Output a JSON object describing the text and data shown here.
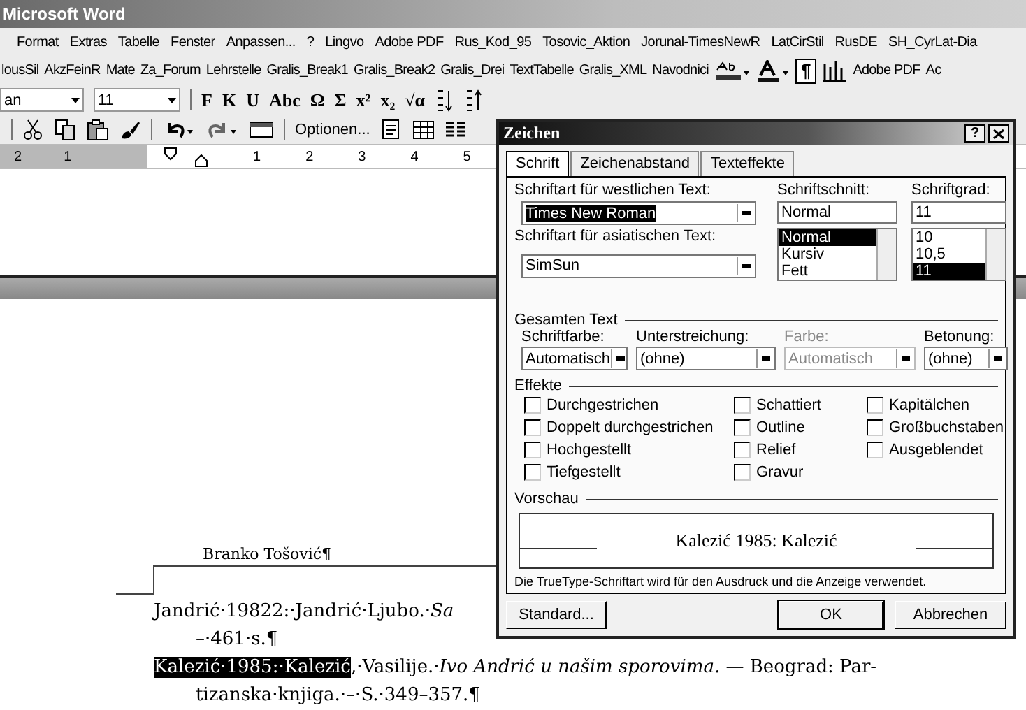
{
  "title_bar": {
    "title": "Microsoft Word"
  },
  "menu_bar": [
    "Format",
    "Extras",
    "Tabelle",
    "Fenster",
    "Anpassen...",
    "?",
    "Lingvo",
    "Adobe PDF",
    "Rus_Kod_95",
    "Tosovic_Aktion",
    "Jorunal-TimesNewR",
    "LatCirStil",
    "RusDE",
    "SH_CyrLat-Dia"
  ],
  "custom_toolbar": {
    "macros": [
      "lousSil",
      "AkzFeinR",
      "Mate",
      "Za_Forum",
      "Lehrstelle",
      "Gralis_Break1",
      "Gralis_Break2",
      "Gralis_Drei",
      "TextTabelle",
      "Gralis_XML",
      "Navodnici"
    ],
    "pilcrow": {
      "label": "¶",
      "on": true
    },
    "pdf": "Adobe PDF",
    "tail": "Ac"
  },
  "formatting_toolbar": {
    "font": "an",
    "size": "11",
    "buttons": [
      "F",
      "K",
      "U",
      "Abc",
      "Ω",
      "Σ",
      "x²",
      "x₂",
      "√α"
    ]
  },
  "standard_toolbar": {
    "options": "Optionen..."
  },
  "ruler": {
    "marks": [
      "2",
      "1",
      "1",
      "2",
      "3",
      "4",
      "5"
    ]
  },
  "document": {
    "header": "Branko Tošović¶",
    "lines": [
      {
        "kind": "first",
        "text": "Jandrić·19822:·Jandrić·Ljubo.·*Sa*"
      },
      {
        "kind": "cont",
        "text": "–·461·s.¶"
      },
      {
        "kind": "first",
        "highlight": "Kalezić·1985:·Kalezić",
        "text": ",·Vasilije.·*Ivo Andrić u našim sporovima.* — Beograd: Par-"
      },
      {
        "kind": "cont",
        "text": "tizanska·knjiga.·–·S.·349–357.¶"
      }
    ]
  },
  "dialog": {
    "title": "Zeichen",
    "help": "?",
    "tabs": [
      {
        "label": "Schrift",
        "selected": true
      },
      {
        "label": "Zeichenabstand",
        "selected": false
      },
      {
        "label": "Texteffekte",
        "selected": false
      }
    ],
    "western_font": {
      "label": "Schriftart für westlichen Text:",
      "value": "Times New Roman",
      "text_selected": true
    },
    "style": {
      "label": "Schriftschnitt:",
      "value": "Normal",
      "options": [
        {
          "label": "Normal",
          "selected": true
        },
        {
          "label": "Kursiv",
          "selected": false
        },
        {
          "label": "Fett",
          "selected": false
        }
      ]
    },
    "size": {
      "label": "Schriftgrad:",
      "value": "11",
      "options": [
        {
          "label": "10",
          "selected": false
        },
        {
          "label": "10,5",
          "selected": false
        },
        {
          "label": "11",
          "selected": true
        }
      ]
    },
    "asian_font": {
      "label": "Schriftart für asiatischen Text:",
      "value": "SimSun",
      "text_selected": false
    },
    "all_text": {
      "title": "Gesamten Text",
      "fields": [
        {
          "label": "Schriftfarbe:",
          "value": "Automatisch",
          "disabled": false
        },
        {
          "label": "Unterstreichung:",
          "value": "(ohne)",
          "disabled": false
        },
        {
          "label": "Farbe:",
          "value": "Automatisch",
          "disabled": true
        },
        {
          "label": "Betonung:",
          "value": "(ohne)",
          "disabled": false
        }
      ]
    },
    "effects": {
      "title": "Effekte",
      "columns": [
        [
          {
            "label": "Durchgestrichen",
            "checked": false
          },
          {
            "label": "Doppelt durchgestrichen",
            "checked": false
          },
          {
            "label": "Hochgestellt",
            "checked": false
          },
          {
            "label": "Tiefgestellt",
            "checked": false
          }
        ],
        [
          {
            "label": "Schattiert",
            "checked": false
          },
          {
            "label": "Outline",
            "checked": false
          },
          {
            "label": "Relief",
            "checked": false
          },
          {
            "label": "Gravur",
            "checked": false
          }
        ],
        [
          {
            "label": "Kapitälchen",
            "checked": false
          },
          {
            "label": "Großbuchstaben",
            "checked": false
          },
          {
            "label": "Ausgeblendet",
            "checked": false
          }
        ]
      ]
    },
    "preview": {
      "title": "Vorschau",
      "text": "Kalezić 1985: Kalezić"
    },
    "note": "Die TrueType-Schriftart wird für den Ausdruck und die Anzeige verwendet.",
    "buttons": [
      {
        "label": "Standard...",
        "default": false
      },
      {
        "label": "OK",
        "default": true
      },
      {
        "label": "Abbrechen",
        "default": false
      }
    ]
  }
}
